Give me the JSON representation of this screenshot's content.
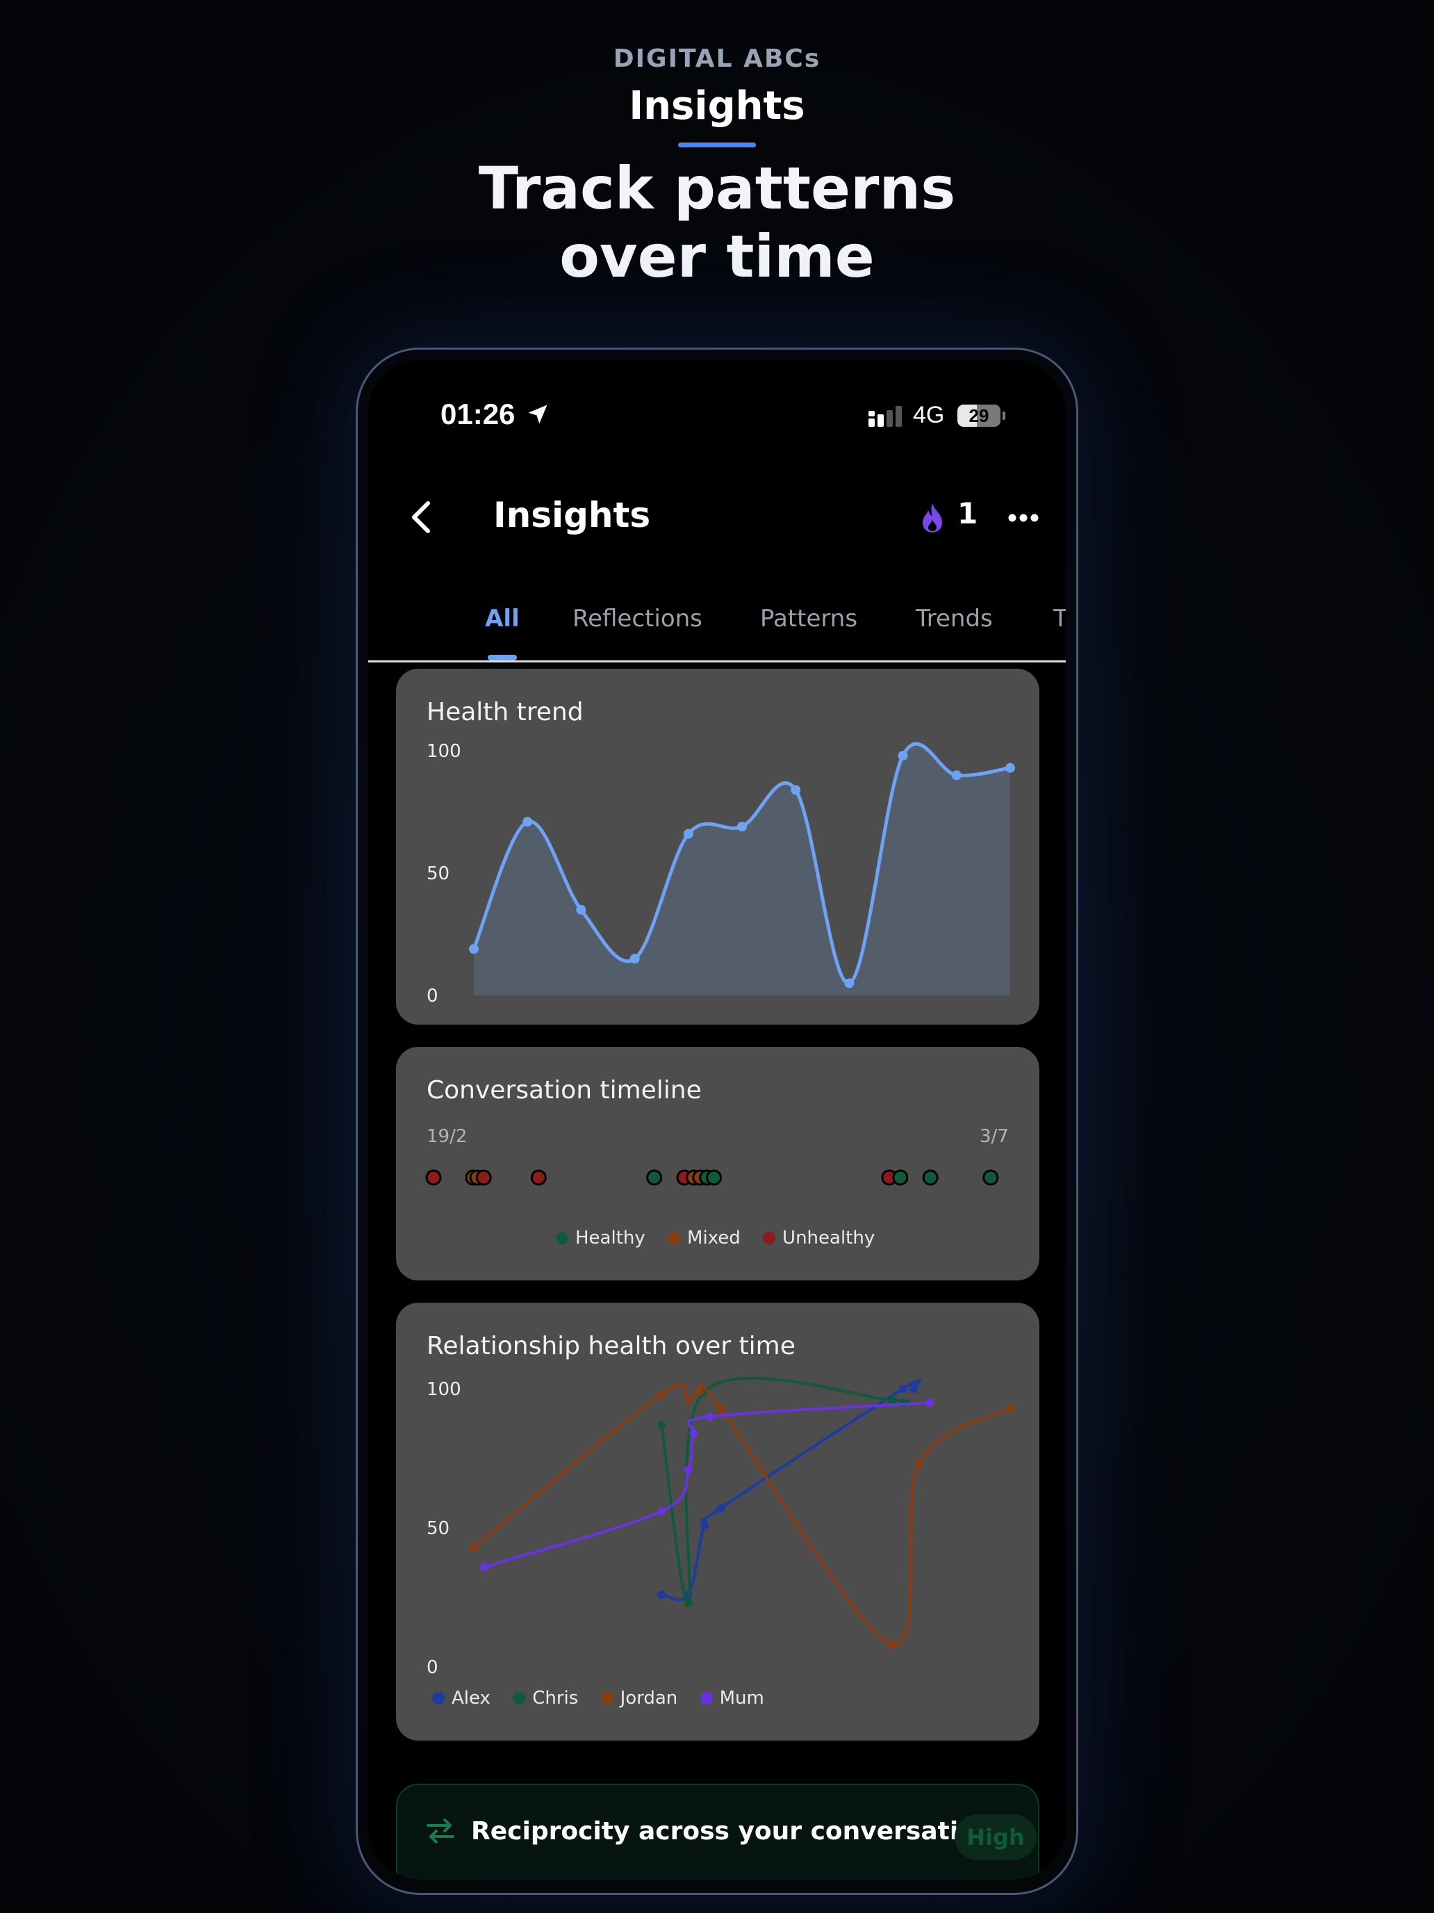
{
  "hero": {
    "brand": "DIGITAL ABCs",
    "title": "Insights",
    "tagline_line1": "Track patterns",
    "tagline_line2": "over time"
  },
  "status_bar": {
    "time": "01:26",
    "network": "4G",
    "battery": "29",
    "icons": [
      "location-arrow-icon",
      "cellular-signal-icon",
      "battery-icon"
    ]
  },
  "header": {
    "back_icon": "chevron-left-icon",
    "title": "Insights",
    "streak_icon": "flame-icon",
    "streak_count": "1",
    "more_icon": "ellipsis-icon"
  },
  "tabs": [
    {
      "label": "All",
      "active": true
    },
    {
      "label": "Reflections",
      "active": false
    },
    {
      "label": "Patterns",
      "active": false
    },
    {
      "label": "Trends",
      "active": false
    },
    {
      "label": "T",
      "active": false
    }
  ],
  "colors": {
    "accent_blue": "#6ea2f5",
    "healthy": "#0e5a3a",
    "mixed": "#8a3c12",
    "unhealthy": "#8e1b1b",
    "alex": "#1f3aa0",
    "chris": "#0e5a3a",
    "jordan": "#8a3c12",
    "mum": "#6a32e0"
  },
  "chart_data": [
    {
      "type": "area",
      "title": "Health trend",
      "yticks": [
        "100",
        "50",
        "0"
      ],
      "ylim": [
        0,
        100
      ],
      "x": [
        0,
        1,
        2,
        3,
        4,
        5,
        6,
        7,
        8,
        9,
        10
      ],
      "values": [
        19,
        71,
        35,
        15,
        66,
        69,
        84,
        5,
        98,
        90,
        93
      ],
      "color": "#6ea2f5"
    },
    {
      "type": "scatter",
      "title": "Conversation timeline",
      "x_start_label": "19/2",
      "x_end_label": "3/7",
      "points": [
        {
          "t": 0.0,
          "category": "Unhealthy"
        },
        {
          "t": 0.075,
          "category": "Mixed"
        },
        {
          "t": 0.083,
          "category": "Mixed"
        },
        {
          "t": 0.095,
          "category": "Unhealthy"
        },
        {
          "t": 0.199,
          "category": "Unhealthy"
        },
        {
          "t": 0.418,
          "category": "Healthy"
        },
        {
          "t": 0.475,
          "category": "Unhealthy"
        },
        {
          "t": 0.493,
          "category": "Mixed"
        },
        {
          "t": 0.505,
          "category": "Mixed"
        },
        {
          "t": 0.518,
          "category": "Healthy"
        },
        {
          "t": 0.531,
          "category": "Healthy"
        },
        {
          "t": 0.863,
          "category": "Unhealthy"
        },
        {
          "t": 0.884,
          "category": "Healthy"
        },
        {
          "t": 0.941,
          "category": "Healthy"
        },
        {
          "t": 1.055,
          "category": "Healthy"
        }
      ],
      "legend": [
        {
          "name": "Healthy",
          "color": "#0e5a3a"
        },
        {
          "name": "Mixed",
          "color": "#8a3c12"
        },
        {
          "name": "Unhealthy",
          "color": "#8e1b1b"
        }
      ]
    },
    {
      "type": "line",
      "title": "Relationship health over time",
      "yticks": [
        "100",
        "50",
        "0"
      ],
      "ylim": [
        0,
        100
      ],
      "series": [
        {
          "name": "Alex",
          "color": "#1f3aa0",
          "points": [
            [
              0.35,
              25
            ],
            [
              0.4,
              25
            ],
            [
              0.43,
              50
            ],
            [
              0.46,
              56
            ],
            [
              0.8,
              99
            ],
            [
              0.82,
              99
            ]
          ]
        },
        {
          "name": "Chris",
          "color": "#0e5a3a",
          "points": [
            [
              0.35,
              86
            ],
            [
              0.4,
              22
            ],
            [
              0.43,
              98
            ],
            [
              0.78,
              95
            ],
            [
              0.8,
              94
            ]
          ]
        },
        {
          "name": "Jordan",
          "color": "#8a3c12",
          "points": [
            [
              0.0,
              42
            ],
            [
              0.35,
              97
            ],
            [
              0.4,
              95
            ],
            [
              0.42,
              98
            ],
            [
              0.46,
              92
            ],
            [
              0.78,
              7
            ],
            [
              0.83,
              72
            ],
            [
              1.0,
              92
            ]
          ]
        },
        {
          "name": "Mum",
          "color": "#6a32e0",
          "points": [
            [
              0.02,
              35
            ],
            [
              0.35,
              55
            ],
            [
              0.4,
              70
            ],
            [
              0.41,
              83
            ],
            [
              0.44,
              89
            ],
            [
              0.85,
              94
            ]
          ]
        }
      ],
      "legend": [
        {
          "name": "Alex",
          "color": "#1f3aa0"
        },
        {
          "name": "Chris",
          "color": "#0e5a3a"
        },
        {
          "name": "Jordan",
          "color": "#8a3c12"
        },
        {
          "name": "Mum",
          "color": "#6a32e0"
        }
      ]
    }
  ],
  "reciprocity": {
    "icon": "swap-arrows-icon",
    "text": "Reciprocity across your conversations",
    "badge": "High"
  }
}
